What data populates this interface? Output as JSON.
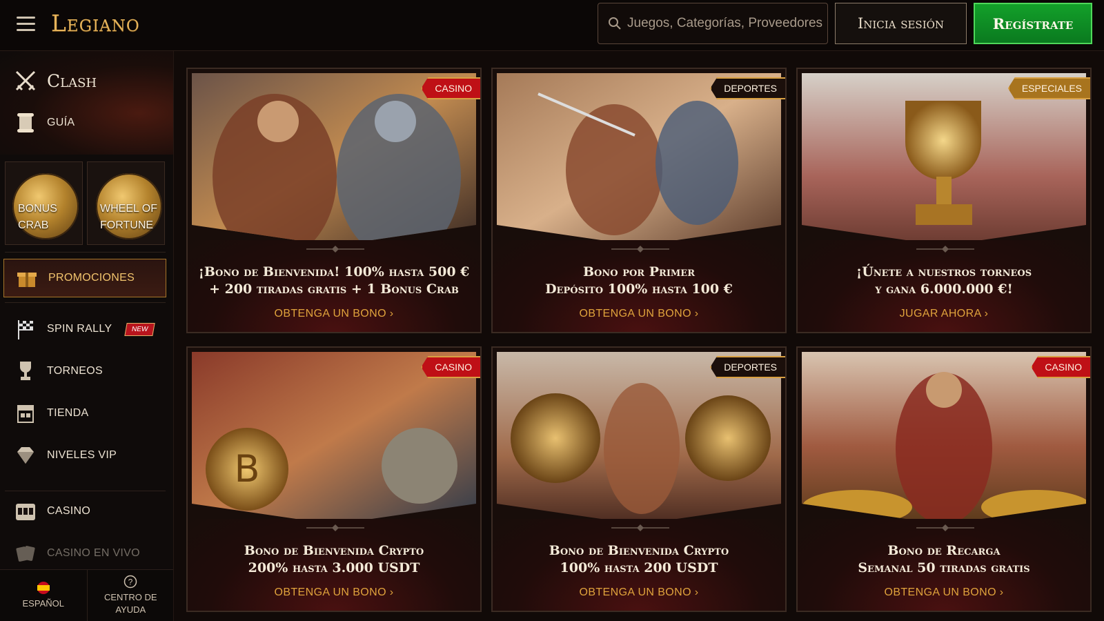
{
  "header": {
    "logo": "Legiano",
    "search_placeholder": "Juegos, Categorías, Proveedores",
    "login_label": "Inicia sesión",
    "register_label": "Regístrate"
  },
  "sidebar": {
    "clash_label": "Clash",
    "guide_label": "GUÍA",
    "tiles": [
      {
        "label_line1": "BONUS",
        "label_line2": "CRAB"
      },
      {
        "label_line1": "WHEEL OF",
        "label_line2": "FORTUNE"
      }
    ],
    "promotions_label": "PROMOCIONES",
    "items": [
      {
        "label": "SPIN RALLY",
        "badge": "NEW"
      },
      {
        "label": "TORNEOS"
      },
      {
        "label": "TIENDA"
      },
      {
        "label": "NIVELES VIP"
      },
      {
        "label": "CASINO"
      },
      {
        "label": "CASINO EN VIVO"
      }
    ],
    "language_label": "ESPAÑOL",
    "help_label_line1": "CENTRO DE",
    "help_label_line2": "AYUDA"
  },
  "cards": [
    {
      "tag": "CASINO",
      "title_line1": "¡Bono de Bienvenida! 100% hasta 500 €",
      "title_line2": "+ 200 tiradas gratis + 1 Bonus Crab",
      "cta": "OBTENGA UN BONO"
    },
    {
      "tag": "DEPORTES",
      "title_line1": "Bono por Primer",
      "title_line2": "Depósito 100% hasta 100 €",
      "cta": "OBTENGA UN BONO"
    },
    {
      "tag": "ESPECIALES",
      "title_line1": "¡Únete a nuestros torneos",
      "title_line2": "y gana 6.000.000 €!",
      "cta": "JUGAR AHORA"
    },
    {
      "tag": "CASINO",
      "title_line1": "Bono de Bienvenida Crypto",
      "title_line2": "200% hasta 3.000 USDT",
      "cta": "OBTENGA UN BONO"
    },
    {
      "tag": "DEPORTES",
      "title_line1": "Bono de Bienvenida Crypto",
      "title_line2": "100% hasta 200 USDT",
      "cta": "OBTENGA UN BONO"
    },
    {
      "tag": "CASINO",
      "title_line1": "Bono de Recarga",
      "title_line2": "Semanal 50 tiradas gratis",
      "cta": "OBTENGA UN BONO"
    }
  ],
  "colors": {
    "accent_gold": "#e0a33c",
    "register_green": "#0f8f25",
    "tag_red": "#bf1016"
  }
}
